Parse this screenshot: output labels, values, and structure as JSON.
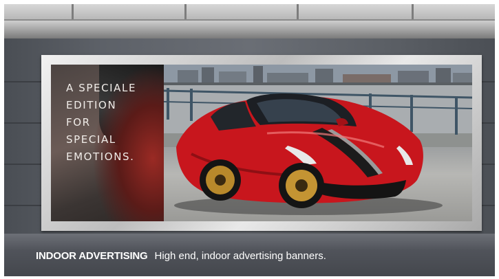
{
  "scene": {
    "billboard_text": [
      "A SPECIALE",
      "EDITION",
      "FOR",
      "SPECIAL",
      "EMOTIONS."
    ],
    "caption_heading": "INDOOR ADVERTISING",
    "caption_text": "High end, indoor advertising banners.",
    "colors": {
      "car_red": "#c8161d",
      "wall": "#5d6168",
      "frame": "#d9d9d9"
    }
  }
}
